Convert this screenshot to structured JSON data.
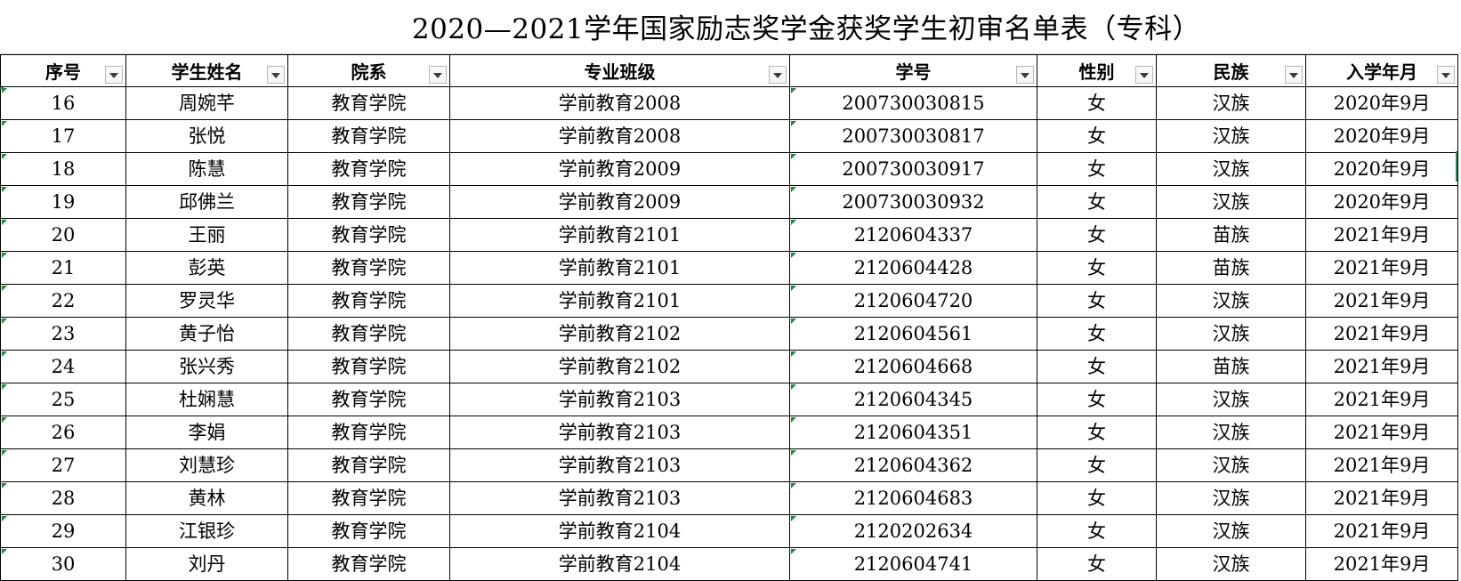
{
  "sheet": {
    "title": "2020—2021学年国家励志奖学金获奖学生初审名单表（专科）",
    "headers": [
      "序号",
      "学生姓名",
      "院系",
      "专业班级",
      "学号",
      "性别",
      "民族",
      "入学年月"
    ],
    "rows": [
      [
        "16",
        "周婉芊",
        "教育学院",
        "学前教育2008",
        "200730030815",
        "女",
        "汉族",
        "2020年9月"
      ],
      [
        "17",
        "张悦",
        "教育学院",
        "学前教育2008",
        "200730030817",
        "女",
        "汉族",
        "2020年9月"
      ],
      [
        "18",
        "陈慧",
        "教育学院",
        "学前教育2009",
        "200730030917",
        "女",
        "汉族",
        "2020年9月"
      ],
      [
        "19",
        "邱佛兰",
        "教育学院",
        "学前教育2009",
        "200730030932",
        "女",
        "汉族",
        "2020年9月"
      ],
      [
        "20",
        "王丽",
        "教育学院",
        "学前教育2101",
        "2120604337",
        "女",
        "苗族",
        "2021年9月"
      ],
      [
        "21",
        "彭英",
        "教育学院",
        "学前教育2101",
        "2120604428",
        "女",
        "苗族",
        "2021年9月"
      ],
      [
        "22",
        "罗灵华",
        "教育学院",
        "学前教育2101",
        "2120604720",
        "女",
        "汉族",
        "2021年9月"
      ],
      [
        "23",
        "黄子怡",
        "教育学院",
        "学前教育2102",
        "2120604561",
        "女",
        "汉族",
        "2021年9月"
      ],
      [
        "24",
        "张兴秀",
        "教育学院",
        "学前教育2102",
        "2120604668",
        "女",
        "苗族",
        "2021年9月"
      ],
      [
        "25",
        "杜娴慧",
        "教育学院",
        "学前教育2103",
        "2120604345",
        "女",
        "汉族",
        "2021年9月"
      ],
      [
        "26",
        "李娟",
        "教育学院",
        "学前教育2103",
        "2120604351",
        "女",
        "汉族",
        "2021年9月"
      ],
      [
        "27",
        "刘慧珍",
        "教育学院",
        "学前教育2103",
        "2120604362",
        "女",
        "汉族",
        "2021年9月"
      ],
      [
        "28",
        "黄林",
        "教育学院",
        "学前教育2103",
        "2120604683",
        "女",
        "汉族",
        "2021年9月"
      ],
      [
        "29",
        "江银珍",
        "教育学院",
        "学前教育2104",
        "2120202634",
        "女",
        "汉族",
        "2021年9月"
      ],
      [
        "30",
        "刘丹",
        "教育学院",
        "学前教育2104",
        "2120604741",
        "女",
        "汉族",
        "2021年9月"
      ]
    ]
  },
  "colors": {
    "grid": "#000000",
    "filter_bg": "#f7f7f7",
    "cell_marker": "#1b8a3a"
  },
  "icons": {
    "filter": "dropdown-filter-icon"
  }
}
